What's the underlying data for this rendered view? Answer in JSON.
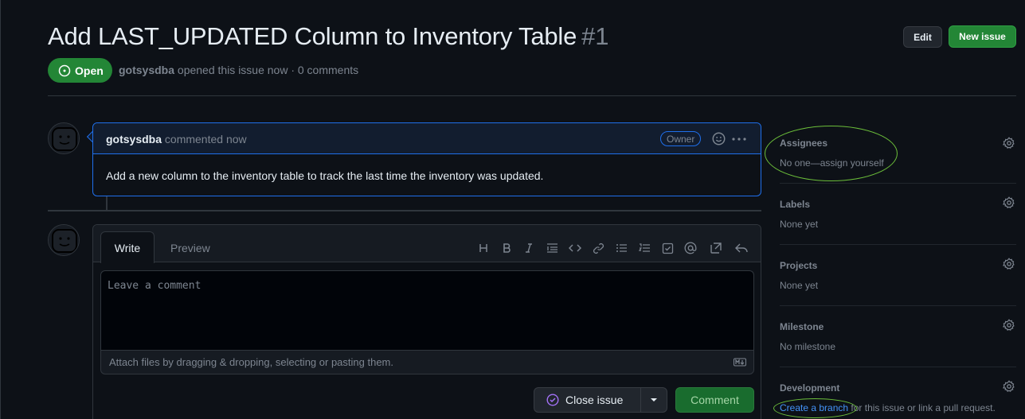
{
  "issue": {
    "title": "Add LAST_UPDATED Column to Inventory Table",
    "number": "#1",
    "state": "Open",
    "author": "gotsysdba",
    "meta_suffix": "opened this issue now · 0 comments"
  },
  "header_buttons": {
    "edit": "Edit",
    "new_issue": "New issue"
  },
  "comment": {
    "author": "gotsysdba",
    "time": "commented now",
    "badge": "Owner",
    "body": "Add a new column to the inventory table to track the last time the inventory was updated."
  },
  "editor": {
    "tab_write": "Write",
    "tab_preview": "Preview",
    "toolbar_icons": [
      "heading-icon",
      "bold-icon",
      "italic-icon",
      "quote-icon",
      "code-icon",
      "link-icon",
      "unordered-list-icon",
      "ordered-list-icon",
      "task-list-icon",
      "mention-icon",
      "reference-icon",
      "reply-icon"
    ],
    "placeholder": "Leave a comment",
    "attach_text": "Attach files by dragging & dropping, selecting or pasting them.",
    "close_issue": "Close issue",
    "comment_button": "Comment"
  },
  "sidebar": {
    "assignees": {
      "title": "Assignees",
      "value": "No one—assign yourself"
    },
    "labels": {
      "title": "Labels",
      "value": "None yet"
    },
    "projects": {
      "title": "Projects",
      "value": "None yet"
    },
    "milestone": {
      "title": "Milestone",
      "value": "No milestone"
    },
    "development": {
      "title": "Development",
      "link": "Create a branch",
      "suffix": " for this issue or link a pull request."
    }
  },
  "colors": {
    "open_green": "#238636",
    "link_blue": "#4493f8",
    "annotation_ring": "#6cbf3a"
  }
}
